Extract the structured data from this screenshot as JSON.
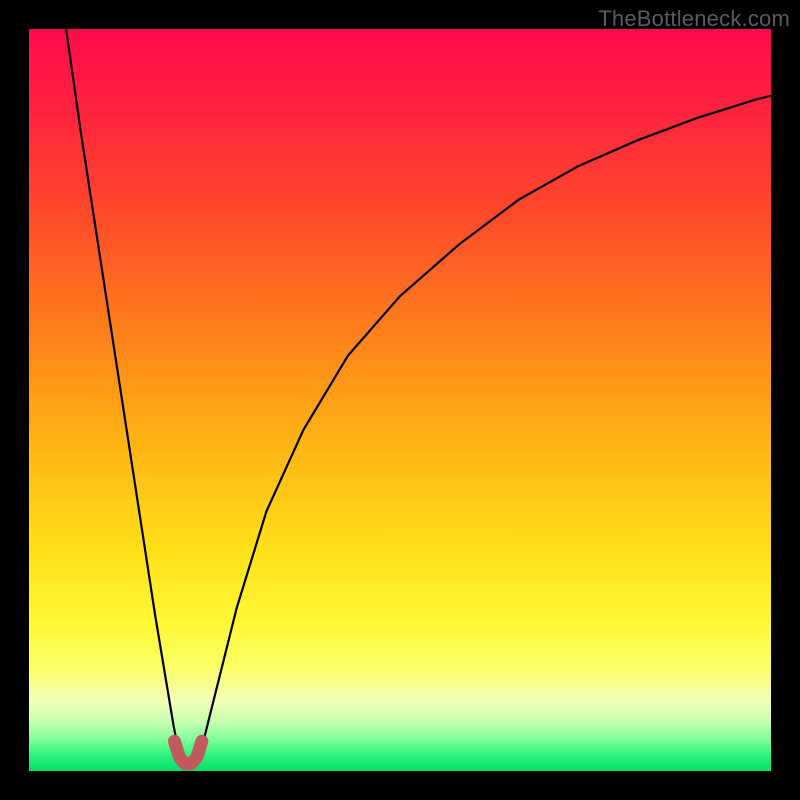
{
  "watermark": "TheBottleneck.com",
  "colors": {
    "frame": "#000000",
    "curve": "#000000",
    "marker": "#c15a5f",
    "gradient_stops": [
      {
        "offset": 0.0,
        "color": "#ff0a4d"
      },
      {
        "offset": 0.1,
        "color": "#ff2040"
      },
      {
        "offset": 0.25,
        "color": "#ff4a2a"
      },
      {
        "offset": 0.4,
        "color": "#ff7d1c"
      },
      {
        "offset": 0.55,
        "color": "#ffb114"
      },
      {
        "offset": 0.7,
        "color": "#ffdf18"
      },
      {
        "offset": 0.8,
        "color": "#fff835"
      },
      {
        "offset": 0.86,
        "color": "#fbff66"
      },
      {
        "offset": 0.905,
        "color": "#f2ffb7"
      },
      {
        "offset": 0.935,
        "color": "#c4ffb0"
      },
      {
        "offset": 0.958,
        "color": "#7dff9a"
      },
      {
        "offset": 0.978,
        "color": "#30f47e"
      },
      {
        "offset": 1.0,
        "color": "#00e06b"
      }
    ]
  },
  "chart_data": {
    "type": "line",
    "title": "",
    "xlabel": "",
    "ylabel": "",
    "xlim": [
      0,
      100
    ],
    "ylim": [
      0,
      100
    ],
    "grid": false,
    "legend": false,
    "series": [
      {
        "name": "curve-left",
        "x": [
          5,
          7,
          9,
          11,
          13,
          15,
          17,
          18.5,
          19.5,
          20.3
        ],
        "y": [
          100,
          86,
          73,
          60,
          47,
          34,
          21,
          12,
          6,
          2
        ]
      },
      {
        "name": "curve-right",
        "x": [
          23,
          24,
          25.5,
          28,
          32,
          37,
          43,
          50,
          58,
          66,
          74,
          82,
          90,
          98,
          100
        ],
        "y": [
          2,
          6,
          12,
          22,
          35,
          46,
          56,
          64,
          71,
          77,
          81.5,
          85,
          88,
          90.5,
          91
        ]
      }
    ],
    "markers": {
      "name": "u-shape",
      "x": [
        19.6,
        20.3,
        21.0,
        21.8,
        22.6,
        23.3
      ],
      "y": [
        4.0,
        1.8,
        1.0,
        1.0,
        1.8,
        4.0
      ]
    },
    "annotations": []
  }
}
